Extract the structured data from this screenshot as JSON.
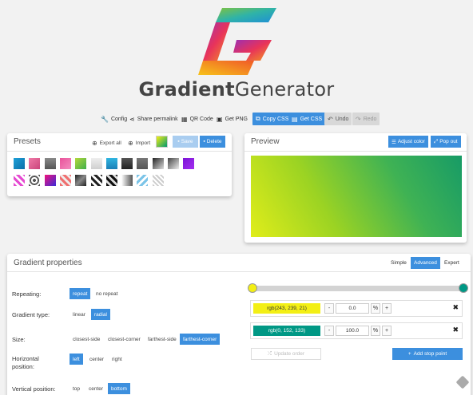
{
  "brand": {
    "name_part1": "Gradient",
    "name_part2": "Generator"
  },
  "toolbar": {
    "config": "Config",
    "share": "Share permalink",
    "qr": "QR Code",
    "png": "Get PNG",
    "copy_css": "Copy CSS",
    "get_css": "Get CSS",
    "undo": "Undo",
    "redo": "Redo"
  },
  "presets": {
    "title": "Presets",
    "export_all": "Export all",
    "import": "Import",
    "save": "Save",
    "delete": "Delete",
    "swatches": [
      "linear-gradient(135deg,#1ea0d8,#0a6fa8)",
      "linear-gradient(135deg,#f07aa8,#c9457a)",
      "linear-gradient(180deg,#8a8a8a,#555)",
      "linear-gradient(135deg,#e9529a,#f38dc0)",
      "linear-gradient(135deg,#b5d83c,#3fae4a)",
      "linear-gradient(180deg,#eeeeee,#cfcfcf)",
      "linear-gradient(180deg,#30b6e0,#1a7fb6)",
      "linear-gradient(180deg,#555,#222)",
      "linear-gradient(180deg,#777,#555)",
      "linear-gradient(135deg,#222,#ddd)",
      "linear-gradient(135deg,#444,#eee)",
      "linear-gradient(135deg,#7c14d6,#a42ff0)",
      "repeating-linear-gradient(45deg,#e54ad1 0 3px,#fff 3px 6px)",
      "repeating-radial-gradient(circle,#555 0 2px,#fff 2px 4px)",
      "linear-gradient(135deg,#f2127a,#3b2ad8)",
      "repeating-linear-gradient(45deg,#f07070 0 3px,#eee 3px 6px)",
      "linear-gradient(135deg,#222,#888,#222)",
      "repeating-linear-gradient(45deg,#222 0 3px,#fff 3px 6px)",
      "repeating-linear-gradient(45deg,#111 0 3px,#ddd 3px 6px)",
      "linear-gradient(90deg,#fff,#555)",
      "repeating-linear-gradient(135deg,#7bc4e8 0 3px,#fff 3px 6px)",
      "repeating-linear-gradient(45deg,#ccc 0 2px,#fff 2px 4px)"
    ]
  },
  "preview": {
    "title": "Preview",
    "adjust_color": "Adjust color",
    "pop_out": "Pop out"
  },
  "properties": {
    "title": "Gradient properties",
    "modes": [
      "Simple",
      "Advanced",
      "Expert"
    ],
    "active_mode": "Advanced",
    "repeating": {
      "label": "Repeating:",
      "options": [
        "repeat",
        "no repeat"
      ],
      "selected": "repeat"
    },
    "type": {
      "label": "Gradient type:",
      "options": [
        "linear",
        "radial"
      ],
      "selected": "radial"
    },
    "size": {
      "label": "Size:",
      "options": [
        "closest-side",
        "closest-corner",
        "farthest-side",
        "farthest-corner"
      ],
      "selected": "farthest-corner"
    },
    "hpos": {
      "label_line1": "Horizontal",
      "label_line2": "position:",
      "options": [
        "left",
        "center",
        "right"
      ],
      "selected": "left"
    },
    "vpos": {
      "label": "Vertical position:",
      "options": [
        "top",
        "center",
        "bottom"
      ],
      "selected": "bottom"
    },
    "stops": [
      {
        "color_label": "rgb(243, 239, 21)",
        "color": "#f3ef15",
        "text_color": "#333",
        "position": "0.0",
        "unit": "%"
      },
      {
        "color_label": "rgb(0, 152, 133)",
        "color": "#009885",
        "text_color": "#fff",
        "position": "100.0",
        "unit": "%"
      }
    ],
    "update_order": "Update order",
    "add_stop": "Add stop point"
  }
}
